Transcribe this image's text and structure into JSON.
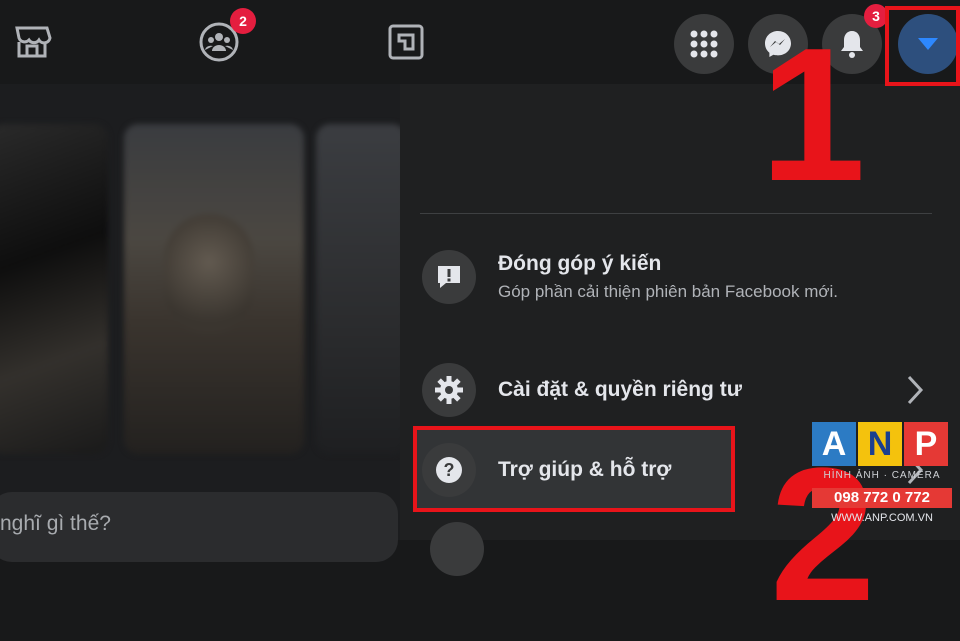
{
  "topbar": {
    "groups_badge": "2",
    "notifications_badge": "3"
  },
  "feed": {
    "compose_placeholder": "nghĩ gì thế?"
  },
  "menu": {
    "feedback": {
      "title": "Đóng góp ý kiến",
      "subtitle": "Góp phần cải thiện phiên bản Facebook mới."
    },
    "settings": {
      "title": "Cài đặt & quyền riêng tư"
    },
    "help": {
      "title": "Trợ giúp & hỗ trợ"
    }
  },
  "annotations": {
    "step1": "1",
    "step2": "2"
  },
  "watermark": {
    "letters": [
      "A",
      "N",
      "P"
    ],
    "tagline": "HÌNH ẢNH · CAMERA",
    "phone": "098 772 0 772",
    "url": "WWW.ANP.COM.VN"
  },
  "colors": {
    "background": "#18191a",
    "menu_bg": "#1f2021",
    "badge": "#e41e3f",
    "annotation_red": "#e8141a",
    "account_blue": "#2d88ff"
  }
}
